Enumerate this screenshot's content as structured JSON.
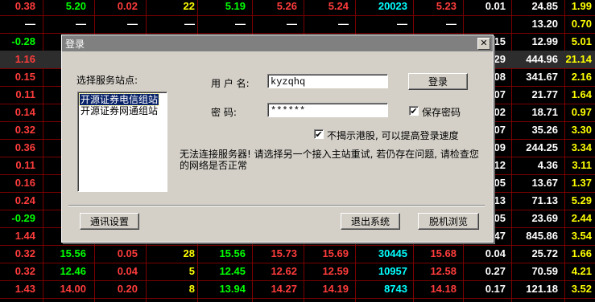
{
  "colors": {
    "red": "#ff3c3c",
    "green": "#00ff00",
    "yellow": "#ffff00",
    "cyan": "#00ffff",
    "white": "#ffffff"
  },
  "table": {
    "rows": [
      [
        {
          "t": "0.38",
          "c": "red"
        },
        {
          "t": "5.20",
          "c": "green"
        },
        {
          "t": "0.02",
          "c": "red"
        },
        {
          "t": "22",
          "c": "yellow"
        },
        {
          "t": "5.19",
          "c": "green"
        },
        {
          "t": "5.26",
          "c": "red"
        },
        {
          "t": "5.24",
          "c": "red"
        },
        {
          "t": "20023",
          "c": "cyan"
        },
        {
          "t": "5.23",
          "c": "red"
        },
        {
          "t": "0.01",
          "c": "white"
        },
        {
          "t": "24.85",
          "c": "white"
        },
        {
          "t": "1.99",
          "c": "yellow"
        }
      ],
      [
        {
          "t": "—",
          "c": "white"
        },
        {
          "t": "—",
          "c": "white"
        },
        {
          "t": "—",
          "c": "white"
        },
        {
          "t": "—",
          "c": "white"
        },
        {
          "t": "—",
          "c": "white"
        },
        {
          "t": "—",
          "c": "white"
        },
        {
          "t": "—",
          "c": "white"
        },
        {
          "t": "—",
          "c": "white"
        },
        {
          "t": "—",
          "c": "white"
        },
        {
          "t": "",
          "c": "white"
        },
        {
          "t": "13.20",
          "c": "white"
        },
        {
          "t": "0.70",
          "c": "yellow"
        }
      ],
      [
        {
          "t": "-0.28",
          "c": "green"
        },
        {
          "t": "",
          "c": "white"
        },
        {
          "t": "",
          "c": "white"
        },
        {
          "t": "",
          "c": "white"
        },
        {
          "t": "",
          "c": "white"
        },
        {
          "t": "",
          "c": "white"
        },
        {
          "t": "",
          "c": "white"
        },
        {
          "t": "",
          "c": "white"
        },
        {
          "t": "",
          "c": "white"
        },
        {
          "t": ".15",
          "c": "white"
        },
        {
          "t": "12.99",
          "c": "white"
        },
        {
          "t": "5.01",
          "c": "yellow"
        }
      ],
      [
        {
          "t": "1.16",
          "c": "red"
        },
        {
          "t": "",
          "c": "white"
        },
        {
          "t": "",
          "c": "white"
        },
        {
          "t": "",
          "c": "white"
        },
        {
          "t": "",
          "c": "white"
        },
        {
          "t": "",
          "c": "white"
        },
        {
          "t": "",
          "c": "white"
        },
        {
          "t": "",
          "c": "white"
        },
        {
          "t": "",
          "c": "white"
        },
        {
          "t": ".29",
          "c": "white"
        },
        {
          "t": "444.96",
          "c": "white"
        },
        {
          "t": "21.14",
          "c": "yellow"
        }
      ],
      [
        {
          "t": "0.15",
          "c": "red"
        },
        {
          "t": "",
          "c": "white"
        },
        {
          "t": "",
          "c": "white"
        },
        {
          "t": "",
          "c": "white"
        },
        {
          "t": "",
          "c": "white"
        },
        {
          "t": "",
          "c": "white"
        },
        {
          "t": "",
          "c": "white"
        },
        {
          "t": "",
          "c": "white"
        },
        {
          "t": "",
          "c": "white"
        },
        {
          "t": ".08",
          "c": "white"
        },
        {
          "t": "341.67",
          "c": "white"
        },
        {
          "t": "2.16",
          "c": "yellow"
        }
      ],
      [
        {
          "t": "0.11",
          "c": "red"
        },
        {
          "t": "",
          "c": "white"
        },
        {
          "t": "",
          "c": "white"
        },
        {
          "t": "",
          "c": "white"
        },
        {
          "t": "",
          "c": "white"
        },
        {
          "t": "",
          "c": "white"
        },
        {
          "t": "",
          "c": "white"
        },
        {
          "t": "",
          "c": "white"
        },
        {
          "t": "",
          "c": "white"
        },
        {
          "t": ".07",
          "c": "white"
        },
        {
          "t": "21.77",
          "c": "white"
        },
        {
          "t": "1.64",
          "c": "yellow"
        }
      ],
      [
        {
          "t": "0.14",
          "c": "red"
        },
        {
          "t": "",
          "c": "white"
        },
        {
          "t": "",
          "c": "white"
        },
        {
          "t": "",
          "c": "white"
        },
        {
          "t": "",
          "c": "white"
        },
        {
          "t": "",
          "c": "white"
        },
        {
          "t": "",
          "c": "white"
        },
        {
          "t": "",
          "c": "white"
        },
        {
          "t": "",
          "c": "white"
        },
        {
          "t": ".02",
          "c": "white"
        },
        {
          "t": "18.71",
          "c": "white"
        },
        {
          "t": "0.97",
          "c": "yellow"
        }
      ],
      [
        {
          "t": "0.32",
          "c": "red"
        },
        {
          "t": "",
          "c": "white"
        },
        {
          "t": "",
          "c": "white"
        },
        {
          "t": "",
          "c": "white"
        },
        {
          "t": "",
          "c": "white"
        },
        {
          "t": "",
          "c": "white"
        },
        {
          "t": "",
          "c": "white"
        },
        {
          "t": "",
          "c": "white"
        },
        {
          "t": "",
          "c": "white"
        },
        {
          "t": ".07",
          "c": "white"
        },
        {
          "t": "35.26",
          "c": "white"
        },
        {
          "t": "3.30",
          "c": "yellow"
        }
      ],
      [
        {
          "t": "0.36",
          "c": "red"
        },
        {
          "t": "",
          "c": "white"
        },
        {
          "t": "",
          "c": "white"
        },
        {
          "t": "",
          "c": "white"
        },
        {
          "t": "",
          "c": "white"
        },
        {
          "t": "",
          "c": "white"
        },
        {
          "t": "",
          "c": "white"
        },
        {
          "t": "",
          "c": "white"
        },
        {
          "t": "",
          "c": "white"
        },
        {
          "t": ".09",
          "c": "white"
        },
        {
          "t": "244.25",
          "c": "white"
        },
        {
          "t": "3.34",
          "c": "yellow"
        }
      ],
      [
        {
          "t": "0.11",
          "c": "red"
        },
        {
          "t": "",
          "c": "white"
        },
        {
          "t": "",
          "c": "white"
        },
        {
          "t": "",
          "c": "white"
        },
        {
          "t": "",
          "c": "white"
        },
        {
          "t": "",
          "c": "white"
        },
        {
          "t": "",
          "c": "white"
        },
        {
          "t": "",
          "c": "white"
        },
        {
          "t": "",
          "c": "white"
        },
        {
          "t": ".12",
          "c": "white"
        },
        {
          "t": "4.36",
          "c": "white"
        },
        {
          "t": "3.11",
          "c": "yellow"
        }
      ],
      [
        {
          "t": "0.16",
          "c": "red"
        },
        {
          "t": "",
          "c": "white"
        },
        {
          "t": "",
          "c": "white"
        },
        {
          "t": "",
          "c": "white"
        },
        {
          "t": "",
          "c": "white"
        },
        {
          "t": "",
          "c": "white"
        },
        {
          "t": "",
          "c": "white"
        },
        {
          "t": "",
          "c": "white"
        },
        {
          "t": "",
          "c": "white"
        },
        {
          "t": ".05",
          "c": "white"
        },
        {
          "t": "13.67",
          "c": "white"
        },
        {
          "t": "1.37",
          "c": "yellow"
        }
      ],
      [
        {
          "t": "0.24",
          "c": "red"
        },
        {
          "t": "",
          "c": "white"
        },
        {
          "t": "",
          "c": "white"
        },
        {
          "t": "",
          "c": "white"
        },
        {
          "t": "",
          "c": "white"
        },
        {
          "t": "",
          "c": "white"
        },
        {
          "t": "",
          "c": "white"
        },
        {
          "t": "",
          "c": "white"
        },
        {
          "t": "",
          "c": "white"
        },
        {
          "t": ".13",
          "c": "white"
        },
        {
          "t": "71.13",
          "c": "white"
        },
        {
          "t": "5.29",
          "c": "yellow"
        }
      ],
      [
        {
          "t": "-0.29",
          "c": "green"
        },
        {
          "t": "",
          "c": "white"
        },
        {
          "t": "",
          "c": "white"
        },
        {
          "t": "",
          "c": "white"
        },
        {
          "t": "",
          "c": "white"
        },
        {
          "t": "",
          "c": "white"
        },
        {
          "t": "",
          "c": "white"
        },
        {
          "t": "",
          "c": "white"
        },
        {
          "t": "",
          "c": "white"
        },
        {
          "t": ".05",
          "c": "white"
        },
        {
          "t": "23.69",
          "c": "white"
        },
        {
          "t": "2.44",
          "c": "yellow"
        }
      ],
      [
        {
          "t": "1.44",
          "c": "red"
        },
        {
          "t": "",
          "c": "white"
        },
        {
          "t": "",
          "c": "white"
        },
        {
          "t": "",
          "c": "white"
        },
        {
          "t": "",
          "c": "white"
        },
        {
          "t": "",
          "c": "white"
        },
        {
          "t": "",
          "c": "white"
        },
        {
          "t": "",
          "c": "white"
        },
        {
          "t": "",
          "c": "white"
        },
        {
          "t": ".47",
          "c": "white"
        },
        {
          "t": "845.86",
          "c": "white"
        },
        {
          "t": "3.54",
          "c": "yellow"
        }
      ],
      [
        {
          "t": "0.32",
          "c": "red"
        },
        {
          "t": "15.56",
          "c": "green"
        },
        {
          "t": "0.05",
          "c": "red"
        },
        {
          "t": "28",
          "c": "yellow"
        },
        {
          "t": "15.56",
          "c": "green"
        },
        {
          "t": "15.73",
          "c": "red"
        },
        {
          "t": "15.69",
          "c": "red"
        },
        {
          "t": "30445",
          "c": "cyan"
        },
        {
          "t": "15.68",
          "c": "red"
        },
        {
          "t": "0.04",
          "c": "white"
        },
        {
          "t": "25.72",
          "c": "white"
        },
        {
          "t": "1.66",
          "c": "yellow"
        }
      ],
      [
        {
          "t": "0.32",
          "c": "red"
        },
        {
          "t": "12.46",
          "c": "green"
        },
        {
          "t": "0.04",
          "c": "red"
        },
        {
          "t": "5",
          "c": "yellow"
        },
        {
          "t": "12.45",
          "c": "green"
        },
        {
          "t": "12.62",
          "c": "red"
        },
        {
          "t": "12.59",
          "c": "red"
        },
        {
          "t": "10957",
          "c": "cyan"
        },
        {
          "t": "12.58",
          "c": "red"
        },
        {
          "t": "0.27",
          "c": "white"
        },
        {
          "t": "70.59",
          "c": "white"
        },
        {
          "t": "4.21",
          "c": "yellow"
        }
      ],
      [
        {
          "t": "1.43",
          "c": "red"
        },
        {
          "t": "14.00",
          "c": "red"
        },
        {
          "t": "0.20",
          "c": "red"
        },
        {
          "t": "8",
          "c": "yellow"
        },
        {
          "t": "13.94",
          "c": "green"
        },
        {
          "t": "14.27",
          "c": "red"
        },
        {
          "t": "14.19",
          "c": "red"
        },
        {
          "t": "8743",
          "c": "cyan"
        },
        {
          "t": "14.18",
          "c": "red"
        },
        {
          "t": "0.17",
          "c": "white"
        },
        {
          "t": "121.18",
          "c": "white"
        },
        {
          "t": "3.52",
          "c": "yellow"
        }
      ]
    ],
    "selected_row": 3
  },
  "dialog": {
    "title": "登录",
    "close": "✕",
    "site_label": "选择服务站点:",
    "sites": [
      "开源证券电信组站",
      "开源证券网通组站"
    ],
    "username_label": "用 户 名:",
    "username_value": "kyzqhq",
    "password_label": "密    码:",
    "password_value": "******",
    "login_button": "登录",
    "save_password_label": "保存密码",
    "save_password_checked": true,
    "hk_option_label": "不揭示港股, 可以提高登录速度",
    "hk_option_checked": true,
    "error_message": "无法连接服务器! 请选择另一个接入主站重试, 若仍存在问题, 请检查您的网络是否正常",
    "comm_settings_button": "通讯设置",
    "exit_button": "退出系统",
    "offline_button": "脱机浏览"
  }
}
